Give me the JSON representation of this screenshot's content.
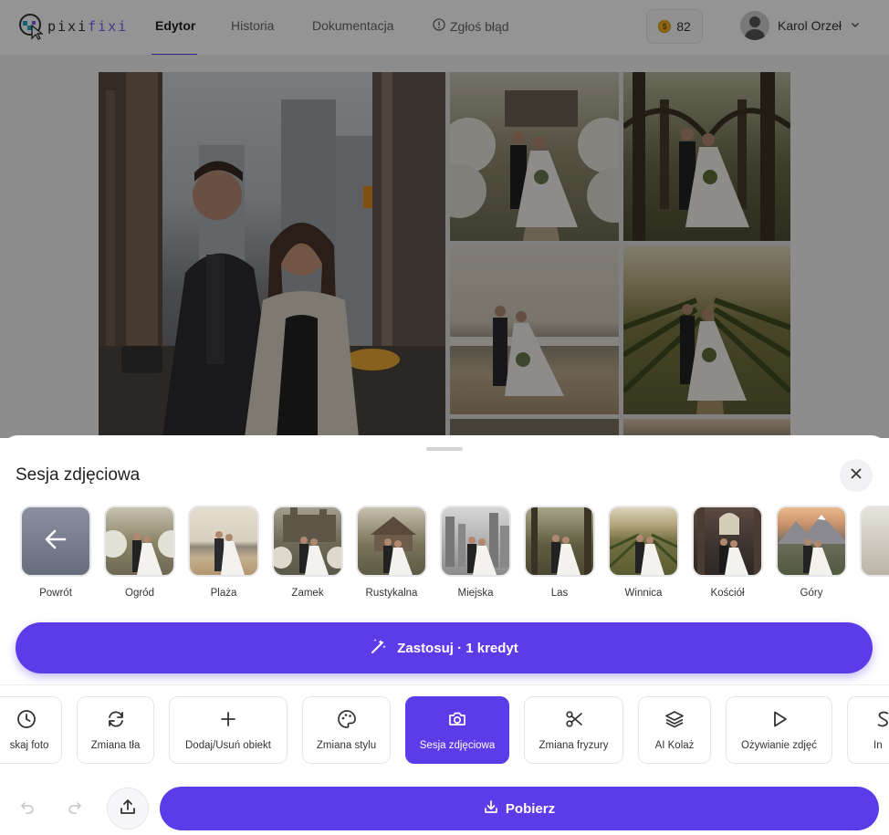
{
  "app": {
    "logo_part1": "pixi",
    "logo_part2": "fixi"
  },
  "nav": {
    "tabs": [
      {
        "label": "Edytor",
        "active": true
      },
      {
        "label": "Historia",
        "active": false
      },
      {
        "label": "Dokumentacja",
        "active": false
      },
      {
        "label": "Zgłoś błąd",
        "active": false,
        "icon": "alert-circle-icon"
      }
    ],
    "credits": "82",
    "user_name": "Karol Orzeł"
  },
  "sheet": {
    "title": "Sesja zdjęciowa",
    "styles": [
      {
        "label": "Powrót",
        "icon": "arrow-left-icon"
      },
      {
        "label": "Ogród"
      },
      {
        "label": "Plaża"
      },
      {
        "label": "Zamek"
      },
      {
        "label": "Rustykalna"
      },
      {
        "label": "Miejska"
      },
      {
        "label": "Las"
      },
      {
        "label": "Winnica"
      },
      {
        "label": "Kościół"
      },
      {
        "label": "Góry"
      }
    ],
    "apply_label": "Zastosuj · 1 kredyt"
  },
  "tools": [
    {
      "label": "skaj foto",
      "icon": "clock-icon"
    },
    {
      "label": "Zmiana tła",
      "icon": "refresh-icon"
    },
    {
      "label": "Dodaj/Usuń obiekt",
      "icon": "plus-icon"
    },
    {
      "label": "Zmiana stylu",
      "icon": "palette-icon"
    },
    {
      "label": "Sesja zdjęciowa",
      "icon": "camera-icon",
      "active": true
    },
    {
      "label": "Zmiana fryzury",
      "icon": "scissors-icon"
    },
    {
      "label": "AI Kolaż",
      "icon": "layers-icon"
    },
    {
      "label": "Ożywianie zdjęć",
      "icon": "play-icon"
    },
    {
      "label": "In",
      "icon": "s-icon"
    }
  ],
  "footer": {
    "download_label": "Pobierz"
  },
  "colors": {
    "accent": "#5b3ce8",
    "logo_accent": "#7c5cf5"
  }
}
